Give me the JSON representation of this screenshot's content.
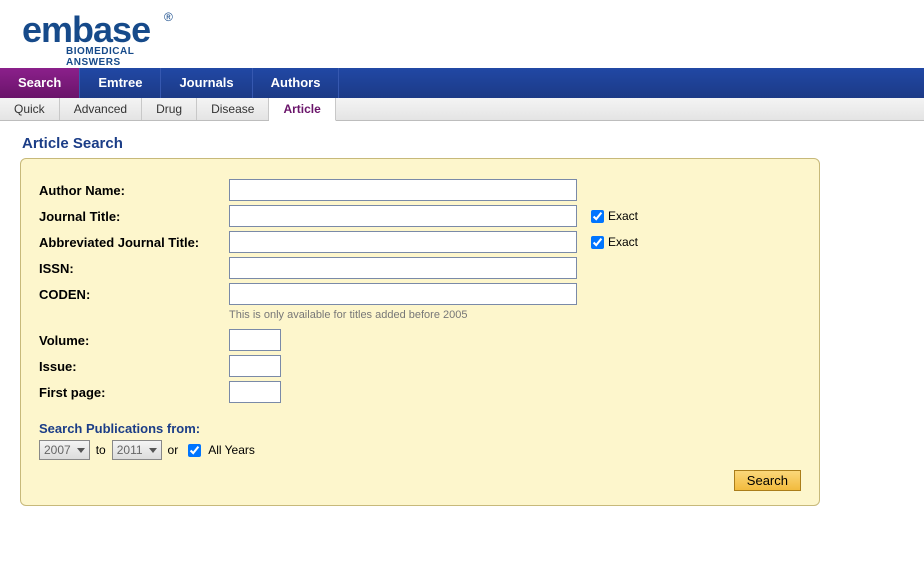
{
  "brand": {
    "name": "embase",
    "tagline": "BIOMEDICAL ANSWERS",
    "reg": "®"
  },
  "nav": {
    "main": [
      {
        "label": "Search",
        "active": true
      },
      {
        "label": "Emtree",
        "active": false
      },
      {
        "label": "Journals",
        "active": false
      },
      {
        "label": "Authors",
        "active": false
      }
    ],
    "sub": [
      {
        "label": "Quick",
        "active": false
      },
      {
        "label": "Advanced",
        "active": false
      },
      {
        "label": "Drug",
        "active": false
      },
      {
        "label": "Disease",
        "active": false
      },
      {
        "label": "Article",
        "active": true
      }
    ]
  },
  "page": {
    "title": "Article Search"
  },
  "form": {
    "author_label": "Author Name:",
    "author_value": "",
    "journal_label": "Journal Title:",
    "journal_value": "",
    "journal_exact_label": "Exact",
    "journal_exact_checked": true,
    "abbrev_label": "Abbreviated Journal Title:",
    "abbrev_value": "",
    "abbrev_exact_label": "Exact",
    "abbrev_exact_checked": true,
    "issn_label": "ISSN:",
    "issn_value": "",
    "coden_label": "CODEN:",
    "coden_value": "",
    "coden_hint": "This is only available for titles added before 2005",
    "volume_label": "Volume:",
    "volume_value": "",
    "issue_label": "Issue:",
    "issue_value": "",
    "firstpage_label": "First page:",
    "firstpage_value": "",
    "pubfrom_title": "Search Publications from:",
    "year_from": "2007",
    "to_label": "to",
    "year_to": "2011",
    "or_label": "or",
    "allyears_label": "All Years",
    "allyears_checked": true,
    "search_button": "Search"
  }
}
